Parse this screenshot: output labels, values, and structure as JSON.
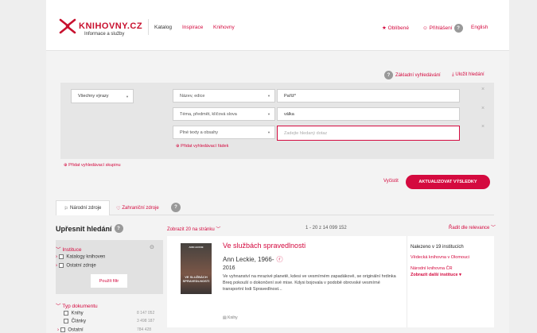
{
  "header": {
    "logo_title": "KNIHOVNY.CZ",
    "logo_subtitle": "Informace a služby",
    "nav": [
      "Katalog",
      "Inspirace",
      "Knihovny"
    ],
    "favorites": "Oblíbené",
    "login": "Přihlášení",
    "language": "English",
    "login_help": "?"
  },
  "search": {
    "basic_search": "Základní vyhledávání",
    "save_search": "Uložit hledání",
    "help": "?",
    "group_operator": "Všechny výrazy",
    "rows": [
      {
        "field": "Název, edice",
        "value": "Paříž*",
        "placeholder": ""
      },
      {
        "field": "Téma, předmět, klíčová slova",
        "value": "válka",
        "placeholder": ""
      },
      {
        "field": "Plné texty a obsahy",
        "value": "",
        "placeholder": "Zadejte hledaný dotaz"
      }
    ],
    "add_row": "Přidat vyhledávací řádek",
    "add_group": "Přidat vyhledávací skupinu",
    "clear": "Vyčistit",
    "update": "AKTUALIZOVAT VÝSLEDKY"
  },
  "tabs": {
    "national": "Národní zdroje",
    "foreign": "Zahraniční zdroje",
    "help": "?"
  },
  "facets": {
    "title": "Upřesnit hledání",
    "help": "?",
    "institutions": {
      "label": "Instituce",
      "items": [
        "Katalogy knihoven",
        "Ostatní zdroje"
      ],
      "apply": "Použít filtr"
    },
    "doctype": {
      "label": "Typ dokumentu",
      "items": [
        {
          "label": "Knihy",
          "count": "8 147 052"
        },
        {
          "label": "Články",
          "count": "3 498 187"
        },
        {
          "label": "Ostatní",
          "count": "784 428"
        }
      ]
    }
  },
  "results_bar": {
    "per_page": "Zobrazit 20 na stránku",
    "range": "1 - 20 z 14 099 152",
    "sort": "Řadit dle relevance"
  },
  "result": {
    "title": "Ve službách spravedlnosti",
    "author": "Ann Leckie, 1966-",
    "year": "2016",
    "description": "Ve vyhnanství na mrazivé planetě, kdesi ve vesmírném zapadákově, se originální hrdinka Breq pokouší o dokončení své mise. Kdysi bojovala v podobě obrovské vesmírné transportní lodi Spravedlnost...",
    "format": "Knihy",
    "cover_author": "ANN LECKIE",
    "cover_title": "VE SLUŽBÁCH SPRAVEDLNOSTI",
    "found_in": "Nalezeno v 19 institucích",
    "institutions": [
      "Vědecká knihovna v Olomouci",
      "Národní knihovna ČR"
    ],
    "more_institutions": "Zobrazit další instituce"
  },
  "colors": {
    "accent": "#d40a3f",
    "panel": "#e6e6e6"
  }
}
